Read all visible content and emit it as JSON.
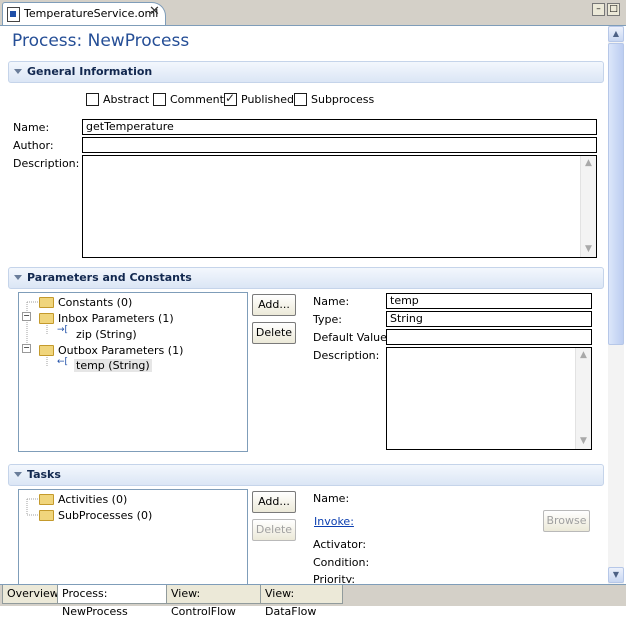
{
  "editor_tab": {
    "label": "TemperatureService.oml",
    "close": "✕"
  },
  "window_controls": {
    "minimize": "–",
    "maximize": "□"
  },
  "page_title": "Process: NewProcess",
  "general": {
    "header": "General Information",
    "checkboxes": [
      {
        "label": "Abstract",
        "checked": false
      },
      {
        "label": "Comment",
        "checked": false
      },
      {
        "label": "Published",
        "checked": true
      },
      {
        "label": "Subprocess",
        "checked": false
      }
    ],
    "name_label": "Name:",
    "name_value": "getTemperature",
    "author_label": "Author:",
    "author_value": "",
    "description_label": "Description:"
  },
  "params": {
    "header": "Parameters and Constants",
    "tree": [
      {
        "label": "Constants (0)"
      },
      {
        "label": "Inbox Parameters (1)"
      },
      {
        "label": "zip (String)"
      },
      {
        "label": "Outbox Parameters (1)"
      },
      {
        "label": "temp (String)"
      }
    ],
    "add_button": "Add...",
    "delete_button": "Delete",
    "name_label": "Name:",
    "name_value": "temp",
    "type_label": "Type:",
    "type_value": "String",
    "default_label": "Default Value:",
    "default_value": "",
    "description_label": "Description:"
  },
  "tasks": {
    "header": "Tasks",
    "tree": [
      {
        "label": "Activities (0)"
      },
      {
        "label": "SubProcesses (0)"
      }
    ],
    "add_button": "Add...",
    "delete_button": "Delete",
    "name_label": "Name:",
    "invoke_link": "Invoke:",
    "browse_button": "Browse",
    "activator_label": "Activator:",
    "condition_label": "Condition:",
    "priority_label": "Priority:"
  },
  "bottom_tabs": [
    "Overview",
    "Process: NewProcess",
    "View: ControlFlow",
    "View: DataFlow"
  ],
  "scroll_arrows": {
    "up": "▲",
    "down": "▼"
  }
}
